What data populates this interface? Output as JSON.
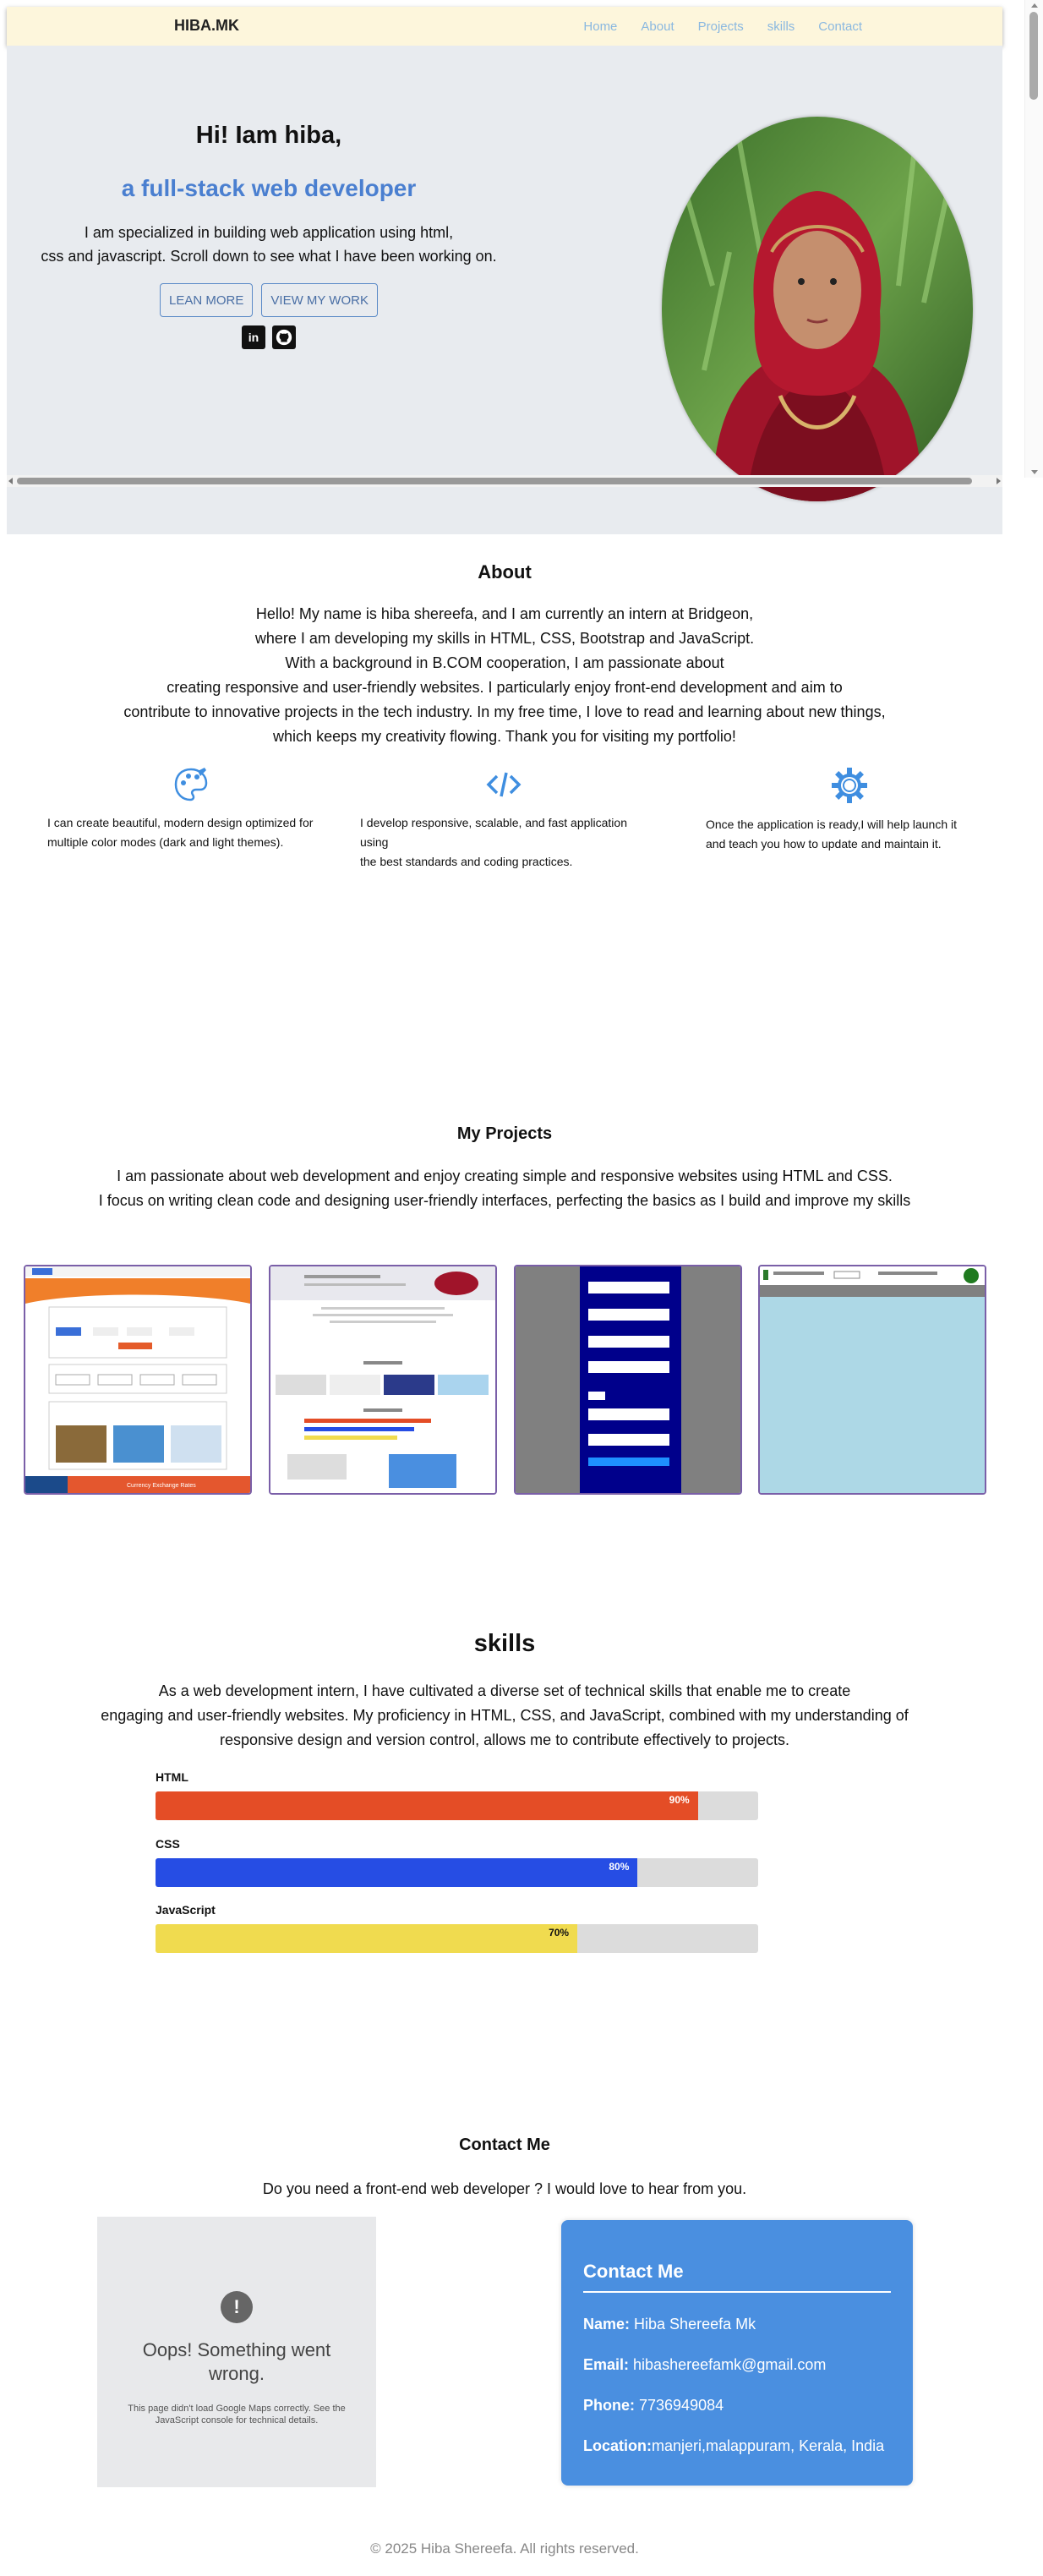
{
  "header": {
    "brand": "HIBA.MK",
    "nav": [
      "Home",
      "About",
      "Projects",
      "skills",
      "Contact"
    ]
  },
  "hero": {
    "greeting": "Hi! Iam hiba,",
    "role": "a full-stack web developer",
    "desc_lines": [
      "I am specialized in building web application using html,",
      "css and javascript. Scroll down to see what I have been working on."
    ],
    "buttons": [
      "LEAN MORE",
      "VIEW MY WORK"
    ],
    "socials": [
      "linkedin-icon",
      "github-icon"
    ]
  },
  "about": {
    "title": "About",
    "lines": [
      "Hello! My name is hiba shereefa, and I am currently an intern at Bridgeon,",
      "where I am developing my skills in HTML, CSS, Bootstrap and JavaScript.",
      "With a background in B.COM cooperation, I am passionate about",
      "creating responsive and user-friendly websites. I particularly enjoy front-end development and aim to",
      "contribute to innovative projects in the tech industry. In my free time, I love to read and learning about new things,",
      "which keeps my creativity flowing. Thank you for visiting my portfolio!"
    ],
    "services": [
      {
        "icon": "palette-icon",
        "lines": [
          "I can create beautiful, modern design optimized for",
          "multiple color modes (dark and light themes)."
        ]
      },
      {
        "icon": "code-icon",
        "lines": [
          "I develop responsive, scalable, and fast application using",
          "the best standards and coding practices."
        ]
      },
      {
        "icon": "gear-icon",
        "lines": [
          "Once the application is ready,I will help launch it",
          "and teach you how to update and maintain it."
        ]
      }
    ],
    "colors": {
      "icon": "#3f8ee0"
    }
  },
  "projects": {
    "title": "My Projects",
    "lines": [
      "I am passionate about web development and enjoy creating simple and responsive websites using HTML and CSS.",
      "I focus on writing clean code and designing user-friendly interfaces, perfecting the basics as I build and improve my skills"
    ],
    "thumbs": [
      {
        "banner": "Currency Exchange Rates"
      },
      {},
      {},
      {}
    ]
  },
  "skills": {
    "title": "skills",
    "lines": [
      "As a web development intern, I have cultivated a diverse set of technical skills that enable me to create",
      "engaging and user-friendly websites. My proficiency in HTML, CSS, and JavaScript, combined with my understanding of",
      "responsive design and version control, allows me to contribute effectively to projects."
    ],
    "items": [
      {
        "name": "HTML",
        "percent": 90,
        "label": "90%",
        "color": "#e44d26",
        "text_color": "#ffffff"
      },
      {
        "name": "CSS",
        "percent": 80,
        "label": "80%",
        "color": "#264de4",
        "text_color": "#ffffff"
      },
      {
        "name": "JavaScript",
        "percent": 70,
        "label": "70%",
        "color": "#f0db4f",
        "text_color": "#111111"
      }
    ]
  },
  "contact": {
    "title": "Contact Me",
    "intro": "Do you need a front-end web developer ? I would love to hear from you.",
    "map_error": {
      "icon": "!",
      "title": "Oops! Something went wrong.",
      "subtitle": "This page didn't load Google Maps correctly. See the JavaScript console for technical details."
    },
    "card": {
      "heading": "Contact Me",
      "rows": [
        {
          "label": "Name:",
          "value": " Hiba Shereefa Mk"
        },
        {
          "label": "Email:",
          "value": " hibashereefamk@gmail.com"
        },
        {
          "label": "Phone:",
          "value": " 7736949084"
        },
        {
          "label": "Location:",
          "value": "manjeri,malappuram, Kerala, India"
        }
      ]
    }
  },
  "footer": {
    "text": "© 2025 Hiba Shereefa. All rights reserved."
  }
}
